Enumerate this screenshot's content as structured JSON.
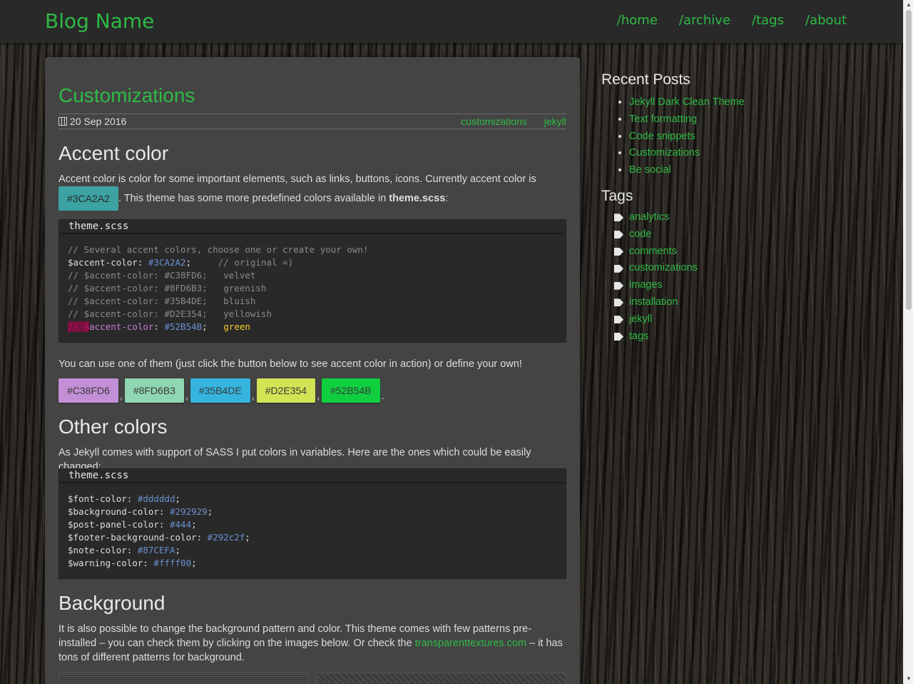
{
  "header": {
    "blog_name": "Blog Name",
    "nav": [
      "/home",
      "/archive",
      "/tags",
      "/about"
    ]
  },
  "post": {
    "title": "Customizations",
    "date": "20 Sep 2016",
    "tags": [
      "customizations",
      "jekyll"
    ],
    "accent": {
      "heading": "Accent color",
      "intro_before": "Accent color is color for some important elements, such as links, buttons, icons. Currently accent color is",
      "accent_chip": "#3CA2A2",
      "intro_after": ". This theme has some more predefined colors available in",
      "intro_file": "theme.scss",
      "intro_end": ":",
      "code_title": "theme.scss",
      "code": [
        {
          "a": "// Several accent colors, choose one or create your own!"
        },
        {
          "v": "$accent-color: ",
          "n": "#3CA2A2",
          "e": ";",
          "c": "     // original =)"
        },
        {
          "a": "// $accent-color: #C38FD6;   velvet"
        },
        {
          "a": "// $accent-color: #8FD6B3;   greenish"
        },
        {
          "a": "// $accent-color: #35B4DE;   bluish"
        },
        {
          "a": "// $accent-color: #D2E354;   yellowish"
        }
      ],
      "last_line": {
        "err": "// $",
        "var": "accent-color",
        "sep": ": ",
        "val": "#52B54B",
        "end": ";   ",
        "word": "green"
      },
      "buttons_intro": "You can use one of them (just click the button below to see accent color in action) or define your own!",
      "buttons": [
        {
          "label": "#C38FD6",
          "color": "#C38FD6"
        },
        {
          "label": "#8FD6B3",
          "color": "#8FD6B3"
        },
        {
          "label": "#35B4DE",
          "color": "#35B4DE"
        },
        {
          "label": "#D2E354",
          "color": "#D2E354"
        },
        {
          "label": "#52B54B",
          "color": "#0fcf3f"
        }
      ]
    },
    "other": {
      "heading": "Other colors",
      "intro": "As Jekyll comes with support of SASS I put colors in variables. Here are the ones which could be easily changed:",
      "code_title": "theme.scss",
      "code": [
        {
          "v": "$font-color: ",
          "n": "#dddddd",
          "e": ";"
        },
        {
          "v": "$background-color: ",
          "n": "#292929",
          "e": ";"
        },
        {
          "v": "$post-panel-color: ",
          "n": "#444",
          "e": ";"
        },
        {
          "v": "$footer-background-color: ",
          "n": "#292c2f",
          "e": ";"
        },
        {
          "v": "$note-color: ",
          "n": "#87CEFA",
          "e": ";"
        },
        {
          "v": "$warning-color: ",
          "n": "#ffff00",
          "e": ";"
        }
      ]
    },
    "background": {
      "heading": "Background",
      "text_before": "It is also possible to change the background pattern and color. This theme comes with few patterns pre-installed – you can check them by clicking on the images below. Or check the",
      "link": "transparenttextures.com",
      "text_after": "– it has tons of different patterns for background."
    }
  },
  "sidebar": {
    "recent_title": "Recent Posts",
    "recent": [
      "Jekyll Dark Clean Theme",
      "Text formatting",
      "Code snippets",
      "Customizations",
      "Be social"
    ],
    "tags_title": "Tags",
    "tags": [
      "analytics",
      "code",
      "comments",
      "customizations",
      "images",
      "installation",
      "jekyll",
      "tags"
    ]
  },
  "colors": {
    "accent": "#2fba46",
    "background": "#292929",
    "panel": "#444444"
  }
}
